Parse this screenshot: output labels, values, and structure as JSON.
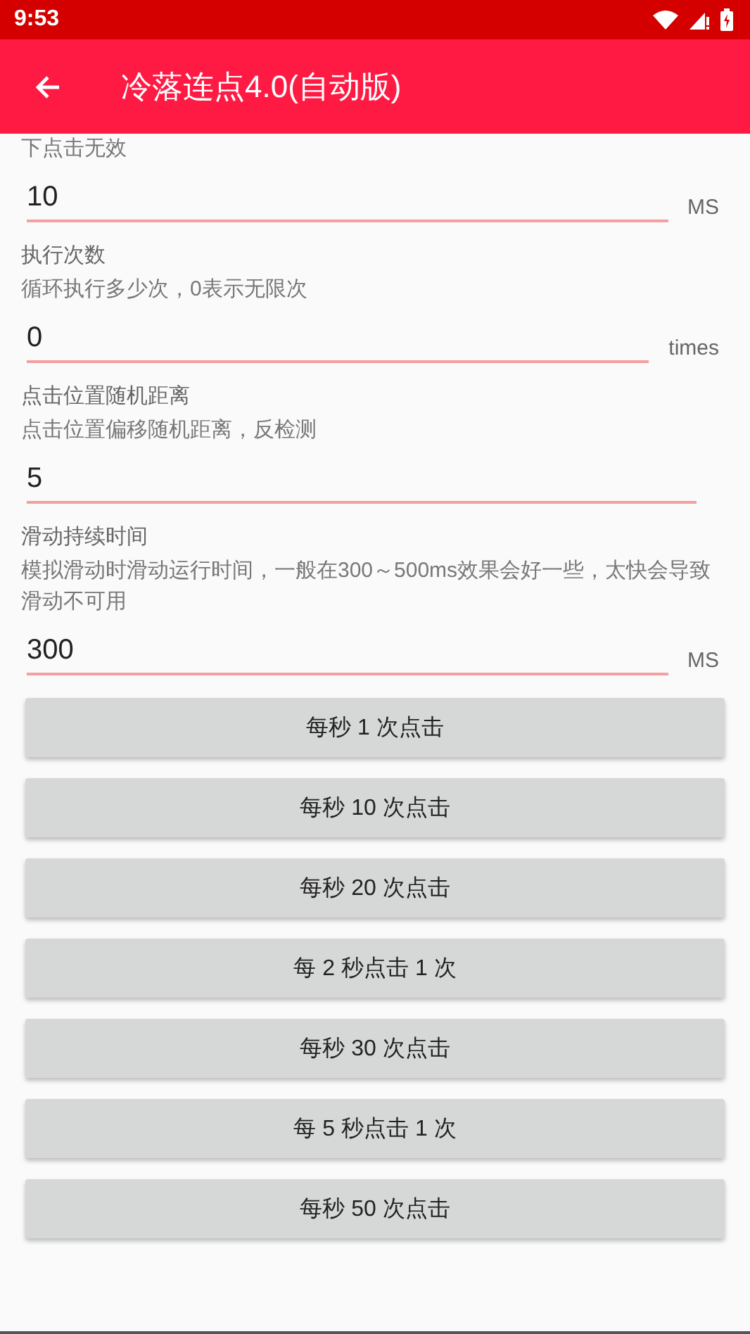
{
  "status_bar": {
    "time": "9:53"
  },
  "app_bar": {
    "title": "冷落连点4.0(自动版)"
  },
  "settings": [
    {
      "description": "下点击无效",
      "value": "10",
      "unit": "MS"
    },
    {
      "title": "执行次数",
      "description": "循环执行多少次，0表示无限次",
      "value": "0",
      "unit": "times"
    },
    {
      "title": "点击位置随机距离",
      "description": "点击位置偏移随机距离，反检测",
      "value": "5"
    },
    {
      "title": "滑动持续时间",
      "description": "模拟滑动时滑动运行时间，一般在300～500ms效果会好一些，太快会导致滑动不可用",
      "value": "300",
      "unit": "MS"
    }
  ],
  "buttons": [
    "每秒 1 次点击",
    "每秒 10 次点击",
    "每秒 20 次点击",
    "每 2 秒点击 1 次",
    "每秒 30 次点击",
    "每 5 秒点击 1 次",
    "每秒 50 次点击"
  ]
}
